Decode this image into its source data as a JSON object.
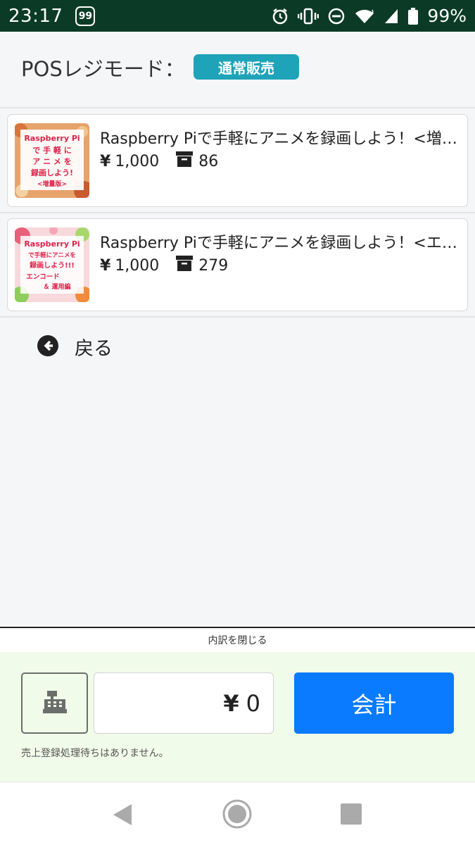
{
  "status_bar": {
    "time": "23:17",
    "notification_count": "99",
    "battery": "99%",
    "icons": [
      "alarm-icon",
      "vibrate-icon",
      "do-not-disturb-icon",
      "wifi-icon",
      "signal-icon",
      "battery-icon"
    ]
  },
  "header": {
    "mode_label": "POSレジモード：",
    "mode_value": "通常販売"
  },
  "products": [
    {
      "title": "Raspberry Piで手軽にアニメを録画しよう！<増量版>",
      "price": "1,000",
      "stock": "86",
      "cover_lines": [
        "Raspberry Pi",
        "で 手 軽 に",
        "ア ニ メ を",
        "録画しよう!",
        "<増量版>"
      ]
    },
    {
      "title": "Raspberry Piで手軽にアニメを録画しよう！<エンコード＆運用編>",
      "price": "1,000",
      "stock": "279",
      "cover_lines": [
        "Raspberry Pi",
        "で手軽にアニメを",
        "録画しよう!!!",
        "エンコード",
        "＆ 運用編"
      ]
    }
  ],
  "yen_symbol": "¥",
  "back_label": "戻る",
  "bottom": {
    "close_detail_label": "内訳を閉じる",
    "amount": "0",
    "checkout_label": "会計",
    "sales_note": "売上登録処理待ちはありません。"
  },
  "colors": {
    "status_bar": "#0b3b26",
    "mode_badge": "#1fa3b8",
    "checkout": "#0a7bff",
    "pos_area": "#f1fbe9"
  }
}
